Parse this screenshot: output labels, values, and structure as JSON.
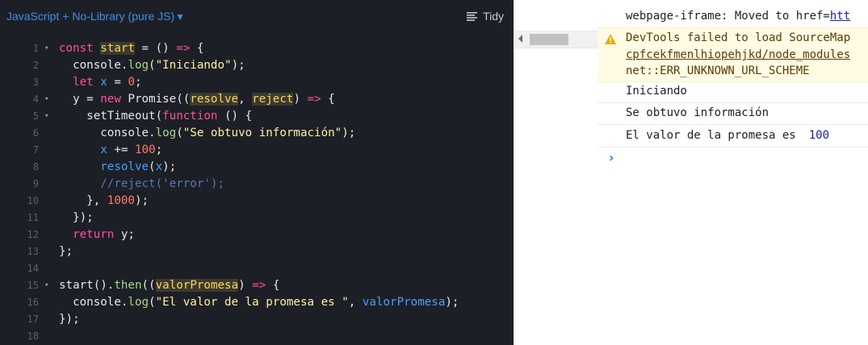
{
  "editor": {
    "language_label": "JavaScript + No-Library (pure JS)",
    "language_caret": "▼",
    "tidy_label": "Tidy",
    "lines": [
      {
        "n": "1",
        "fold": "▾",
        "tokens": [
          [
            "kw",
            "const "
          ],
          [
            "hl",
            "start"
          ],
          [
            "plain",
            " = () "
          ],
          [
            "kw",
            "=>"
          ],
          [
            "plain",
            " {"
          ]
        ]
      },
      {
        "n": "2",
        "fold": "",
        "tokens": [
          [
            "plain",
            "  console."
          ],
          [
            "fn",
            "log"
          ],
          [
            "plain",
            "("
          ],
          [
            "str",
            "\"Iniciando\""
          ],
          [
            "plain",
            ");"
          ]
        ]
      },
      {
        "n": "3",
        "fold": "",
        "tokens": [
          [
            "plain",
            "  "
          ],
          [
            "kw",
            "let "
          ],
          [
            "var",
            "x"
          ],
          [
            "plain",
            " = "
          ],
          [
            "num",
            "0"
          ],
          [
            "plain",
            ";"
          ]
        ]
      },
      {
        "n": "4",
        "fold": "▾",
        "tokens": [
          [
            "plain",
            "  y = "
          ],
          [
            "kw",
            "new "
          ],
          [
            "plain",
            "Promise(("
          ],
          [
            "hl",
            "resolve"
          ],
          [
            "plain",
            ", "
          ],
          [
            "hl",
            "reject"
          ],
          [
            "plain",
            ") "
          ],
          [
            "kw",
            "=>"
          ],
          [
            "plain",
            " {"
          ]
        ]
      },
      {
        "n": "5",
        "fold": "▾",
        "tokens": [
          [
            "plain",
            "    setTimeout("
          ],
          [
            "kw",
            "function"
          ],
          [
            "plain",
            " () {"
          ]
        ]
      },
      {
        "n": "6",
        "fold": "",
        "tokens": [
          [
            "plain",
            "      console."
          ],
          [
            "fn",
            "log"
          ],
          [
            "plain",
            "("
          ],
          [
            "str",
            "\"Se obtuvo información\""
          ],
          [
            "plain",
            ");"
          ]
        ]
      },
      {
        "n": "7",
        "fold": "",
        "tokens": [
          [
            "plain",
            "      "
          ],
          [
            "var",
            "x"
          ],
          [
            "plain",
            " += "
          ],
          [
            "num",
            "100"
          ],
          [
            "plain",
            ";"
          ]
        ]
      },
      {
        "n": "8",
        "fold": "",
        "tokens": [
          [
            "plain",
            "      "
          ],
          [
            "var",
            "resolve"
          ],
          [
            "plain",
            "("
          ],
          [
            "var",
            "x"
          ],
          [
            "plain",
            ");"
          ]
        ]
      },
      {
        "n": "9",
        "fold": "",
        "tokens": [
          [
            "cmt",
            "      //reject('error');"
          ]
        ]
      },
      {
        "n": "10",
        "fold": "",
        "tokens": [
          [
            "plain",
            "    }, "
          ],
          [
            "num",
            "1000"
          ],
          [
            "plain",
            ");"
          ]
        ]
      },
      {
        "n": "11",
        "fold": "",
        "tokens": [
          [
            "plain",
            "  });"
          ]
        ]
      },
      {
        "n": "12",
        "fold": "",
        "tokens": [
          [
            "plain",
            "  "
          ],
          [
            "kw",
            "return "
          ],
          [
            "plain",
            "y;"
          ]
        ]
      },
      {
        "n": "13",
        "fold": "",
        "tokens": [
          [
            "plain",
            "};"
          ]
        ]
      },
      {
        "n": "14",
        "fold": "",
        "tokens": []
      },
      {
        "n": "15",
        "fold": "▾",
        "tokens": [
          [
            "plain",
            "start()."
          ],
          [
            "fn",
            "then"
          ],
          [
            "plain",
            "(("
          ],
          [
            "hl",
            "valorPromesa"
          ],
          [
            "plain",
            ") "
          ],
          [
            "kw",
            "=>"
          ],
          [
            "plain",
            " {"
          ]
        ]
      },
      {
        "n": "16",
        "fold": "",
        "tokens": [
          [
            "plain",
            "  console."
          ],
          [
            "fn",
            "log"
          ],
          [
            "plain",
            "("
          ],
          [
            "str",
            "\"El valor de la promesa es \""
          ],
          [
            "plain",
            ", "
          ],
          [
            "var",
            "valorPromesa"
          ],
          [
            "plain",
            ");"
          ]
        ]
      },
      {
        "n": "17",
        "fold": "",
        "tokens": [
          [
            "plain",
            "});"
          ]
        ]
      },
      {
        "n": "18",
        "fold": "",
        "tokens": []
      }
    ]
  },
  "console": {
    "msg1_prefix": "webpage-iframe: Moved to href=",
    "msg1_link": "htt",
    "warn_line1": "DevTools failed to load SourceMap",
    "warn_line2": "cpfcekfmenlhiopehjkd/node_modules",
    "warn_line3": "net::ERR_UNKNOWN_URL_SCHEME",
    "log1": "Iniciando",
    "log2": "Se obtuvo información",
    "log3_text": "El valor de la promesa es",
    "log3_value": "100",
    "prompt": "›"
  },
  "colors": {
    "editor_bg": "#1d1f26",
    "keyword": "#ff4fa6",
    "variable": "#4c9cff",
    "string": "#fff0a3",
    "number": "#ff7c69",
    "comment": "#5879b4",
    "function": "#a4d88c",
    "warning_bg": "#fffbe5",
    "warning_icon": "#f2a600"
  }
}
